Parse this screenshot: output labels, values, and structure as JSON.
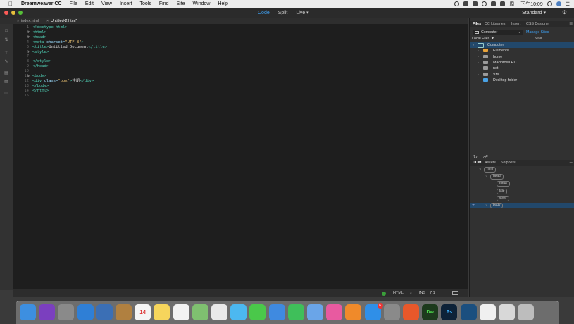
{
  "menubar": {
    "app_name": "Dreamweaver CC",
    "items": [
      "File",
      "Edit",
      "View",
      "Insert",
      "Tools",
      "Find",
      "Site",
      "Window",
      "Help"
    ],
    "clock": "周一 下午10:09"
  },
  "toolbar": {
    "views": [
      "Code",
      "Split",
      "Live"
    ],
    "active_view": "Code",
    "workspace": "Standard"
  },
  "doc_tabs": [
    "index.html",
    "Untitled-2.html*"
  ],
  "code": {
    "lines": [
      {
        "n": "1",
        "fold": "",
        "segments": [
          {
            "c": "tag",
            "t": "<!doctype html>"
          }
        ]
      },
      {
        "n": "2",
        "fold": "▼",
        "segments": [
          {
            "c": "tag",
            "t": "<html>"
          }
        ]
      },
      {
        "n": "3",
        "fold": "▼",
        "segments": [
          {
            "c": "tag",
            "t": "<head>"
          }
        ]
      },
      {
        "n": "4",
        "fold": "",
        "segments": [
          {
            "c": "tag",
            "t": "<meta "
          },
          {
            "c": "attr",
            "t": "charset="
          },
          {
            "c": "str",
            "t": "\"UTF-8\""
          },
          {
            "c": "tag",
            "t": ">"
          }
        ]
      },
      {
        "n": "5",
        "fold": "",
        "segments": [
          {
            "c": "tag",
            "t": "<title>"
          },
          {
            "c": "txt",
            "t": "Untitled Document"
          },
          {
            "c": "tag",
            "t": "</title>"
          }
        ]
      },
      {
        "n": "6",
        "fold": "▼",
        "segments": [
          {
            "c": "tag",
            "t": "<style>"
          }
        ]
      },
      {
        "n": "7",
        "fold": "",
        "segments": []
      },
      {
        "n": "8",
        "fold": "",
        "segments": [
          {
            "c": "tag",
            "t": "</style>"
          }
        ]
      },
      {
        "n": "9",
        "fold": "",
        "segments": [
          {
            "c": "tag",
            "t": "</head>"
          }
        ]
      },
      {
        "n": "10",
        "fold": "",
        "segments": []
      },
      {
        "n": "11",
        "fold": "▼",
        "segments": [
          {
            "c": "tag",
            "t": "<body>"
          }
        ]
      },
      {
        "n": "12",
        "fold": "",
        "segments": [
          {
            "c": "tag",
            "t": "<div "
          },
          {
            "c": "attr",
            "t": "class="
          },
          {
            "c": "str",
            "t": "\"box\""
          },
          {
            "c": "tag",
            "t": ">"
          },
          {
            "c": "txt",
            "t": "注册"
          },
          {
            "c": "tag",
            "t": "</div>"
          }
        ]
      },
      {
        "n": "13",
        "fold": "",
        "segments": [
          {
            "c": "tag",
            "t": "</body>"
          }
        ]
      },
      {
        "n": "14",
        "fold": "",
        "segments": [
          {
            "c": "tag",
            "t": "</html>"
          }
        ]
      },
      {
        "n": "15",
        "fold": "",
        "segments": []
      }
    ]
  },
  "status": {
    "language": "HTML",
    "mode": "INS",
    "cursor": "7:1"
  },
  "files_panel": {
    "tabs": [
      "Files",
      "CC Libraries",
      "Insert",
      "CSS Designer"
    ],
    "active_tab": "Files",
    "location": "Computer",
    "manage_sites": "Manage Sites",
    "local_files": "Local Files ▼",
    "size": "Size",
    "tree": [
      {
        "label": "Computer",
        "level": 0,
        "expanded": true,
        "icon": "computer-icon",
        "selected": true
      },
      {
        "label": "Elements",
        "level": 1,
        "icon": "drive-icon",
        "color": "#e8a33a"
      },
      {
        "label": "home",
        "level": 1,
        "icon": "drive-icon",
        "color": "#9a9a9a"
      },
      {
        "label": "Macintosh HD",
        "level": 1,
        "icon": "drive-icon",
        "color": "#9a9a9a"
      },
      {
        "label": "net",
        "level": 1,
        "icon": "drive-icon",
        "color": "#9a9a9a"
      },
      {
        "label": "VM",
        "level": 1,
        "icon": "drive-icon",
        "color": "#9a9a9a"
      },
      {
        "label": "Desktop folder",
        "level": 1,
        "icon": "folder-icon",
        "color": "#4aa3e6"
      }
    ]
  },
  "dom_panel": {
    "tabs": [
      "DOM",
      "Assets",
      "Snippets"
    ],
    "active_tab": "DOM",
    "nodes": [
      {
        "label": "html",
        "level": 0
      },
      {
        "label": "head",
        "level": 1
      },
      {
        "label": "meta",
        "level": 2
      },
      {
        "label": "title",
        "level": 2
      },
      {
        "label": "style",
        "level": 2
      },
      {
        "label": "body",
        "level": 1
      }
    ]
  },
  "dock": {
    "items": [
      {
        "name": "finder-icon",
        "color": "#3d8fe0"
      },
      {
        "name": "siri-icon",
        "color": "#7b3fbf"
      },
      {
        "name": "launchpad-icon",
        "color": "#8a8a8a"
      },
      {
        "name": "safari-icon",
        "color": "#2f7fd6"
      },
      {
        "name": "mail-icon",
        "color": "#3b6fb5"
      },
      {
        "name": "notes-brown-icon",
        "color": "#b08040"
      },
      {
        "name": "calendar-icon",
        "color": "#f4f4f4",
        "text": "14"
      },
      {
        "name": "notes-icon",
        "color": "#f6d55c"
      },
      {
        "name": "reminders-icon",
        "color": "#f2f2f2"
      },
      {
        "name": "maps-icon",
        "color": "#7fc070"
      },
      {
        "name": "photos-icon",
        "color": "#e9e9e9"
      },
      {
        "name": "messages-icon",
        "color": "#4cb8f0"
      },
      {
        "name": "facetime-icon",
        "color": "#4ac84a"
      },
      {
        "name": "keynote-icon",
        "color": "#3f8ae0"
      },
      {
        "name": "numbers-icon",
        "color": "#3fbf5a"
      },
      {
        "name": "keynote2-icon",
        "color": "#6aa5e8"
      },
      {
        "name": "itunes-icon",
        "color": "#e85aa0"
      },
      {
        "name": "ibooks-icon",
        "color": "#f08a2a"
      },
      {
        "name": "appstore-icon",
        "color": "#2f8fe8",
        "badge": "6"
      },
      {
        "name": "system-preferences-icon",
        "color": "#8a8a8a"
      },
      {
        "name": "firefox-icon",
        "color": "#e8582a"
      },
      {
        "name": "dreamweaver-icon",
        "color": "#1d3a1d",
        "text": "Dw",
        "text_color": "#4cd84c"
      },
      {
        "name": "photoshop-icon",
        "color": "#0d2238",
        "text": "Ps",
        "text_color": "#3ab0ff"
      },
      {
        "name": "quicktime-icon",
        "color": "#1b4f7f"
      },
      {
        "name": "preview-icon",
        "color": "#f0f0f0"
      },
      {
        "name": "screen-icon",
        "color": "#d8d8d8"
      },
      {
        "name": "trash-icon",
        "color": "#bdbdbd"
      }
    ]
  }
}
